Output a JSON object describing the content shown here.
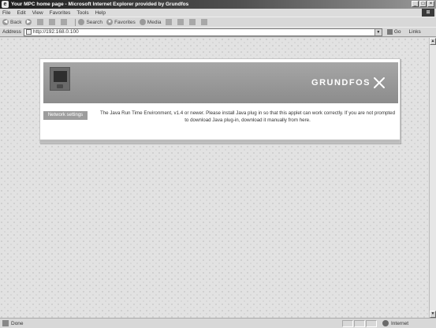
{
  "window": {
    "title": "Your MPC home page - Microsoft Internet Explorer provided by Grundfos",
    "icon": "ie-icon",
    "controls": [
      "_",
      "□",
      "×"
    ]
  },
  "menubar": {
    "items": [
      "File",
      "Edit",
      "View",
      "Favorites",
      "Tools",
      "Help"
    ]
  },
  "toolbar": {
    "back_label": "Back",
    "search_label": "Search",
    "favorites_label": "Favorites",
    "media_label": "Media"
  },
  "address": {
    "label": "Address",
    "url": "http://192.168.0.100",
    "go_label": "Go",
    "links_label": "Links"
  },
  "page": {
    "brand": "GRUNDFOS",
    "sidebar_button": "Network settings",
    "message": "The Java Run Time Environment, v1.4 or newer. Please install Java plug in so that this applet can work correctly. If you are not prompted to download Java plug-in, download it manually from here."
  },
  "status": {
    "text": "Done",
    "zone": "Internet"
  }
}
